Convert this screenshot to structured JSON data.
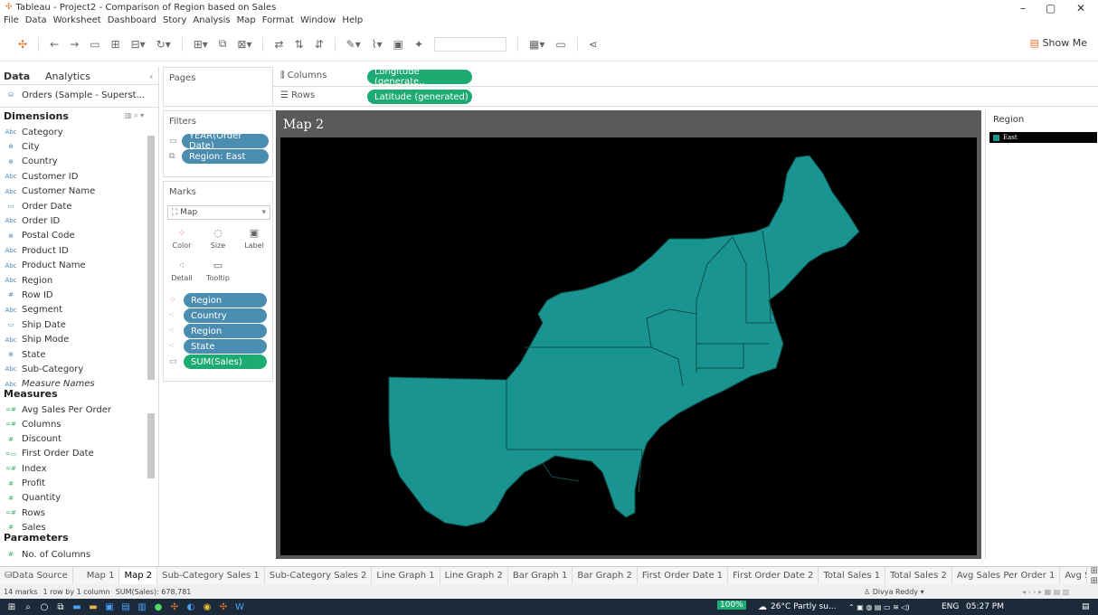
{
  "window": {
    "title": "Tableau - Project2 - Comparison of Region based on Sales"
  },
  "menu": [
    "File",
    "Data",
    "Worksheet",
    "Dashboard",
    "Story",
    "Analysis",
    "Map",
    "Format",
    "Window",
    "Help"
  ],
  "toolbar": {
    "show_me": "Show Me"
  },
  "data_panel": {
    "tab_data": "Data",
    "tab_analytics": "Analytics",
    "datasource": "Orders (Sample - Superst...",
    "dimensions_label": "Dimensions",
    "dimensions": [
      {
        "icon": "Abc",
        "name": "Category"
      },
      {
        "icon": "⊕",
        "name": "City"
      },
      {
        "icon": "⊕",
        "name": "Country"
      },
      {
        "icon": "Abc",
        "name": "Customer ID"
      },
      {
        "icon": "Abc",
        "name": "Customer Name"
      },
      {
        "icon": "▭",
        "name": "Order Date"
      },
      {
        "icon": "Abc",
        "name": "Order ID"
      },
      {
        "icon": "⊕",
        "name": "Postal Code"
      },
      {
        "icon": "Abc",
        "name": "Product ID"
      },
      {
        "icon": "Abc",
        "name": "Product Name"
      },
      {
        "icon": "Abc",
        "name": "Region"
      },
      {
        "icon": "#",
        "name": "Row ID"
      },
      {
        "icon": "Abc",
        "name": "Segment"
      },
      {
        "icon": "▭",
        "name": "Ship Date"
      },
      {
        "icon": "Abc",
        "name": "Ship Mode"
      },
      {
        "icon": "⊕",
        "name": "State"
      },
      {
        "icon": "Abc",
        "name": "Sub-Category"
      },
      {
        "icon": "Abc",
        "name": "Measure Names"
      }
    ],
    "measures_label": "Measures",
    "measures": [
      {
        "icon": "=#",
        "name": "Avg Sales Per Order"
      },
      {
        "icon": "=#",
        "name": "Columns"
      },
      {
        "icon": "#",
        "name": "Discount"
      },
      {
        "icon": "=▭",
        "name": "First Order Date"
      },
      {
        "icon": "=#",
        "name": "Index"
      },
      {
        "icon": "#",
        "name": "Profit"
      },
      {
        "icon": "#",
        "name": "Quantity"
      },
      {
        "icon": "=#",
        "name": "Rows"
      },
      {
        "icon": "#",
        "name": "Sales"
      }
    ],
    "parameters_label": "Parameters",
    "parameters": [
      {
        "icon": "#",
        "name": "No. of Columns"
      }
    ]
  },
  "pages": {
    "label": "Pages"
  },
  "filters": {
    "label": "Filters",
    "items": [
      "YEAR(Order Date)",
      "Region: East"
    ]
  },
  "marks": {
    "label": "Marks",
    "type": "Map",
    "buttons": [
      "Color",
      "Size",
      "Label",
      "Detail",
      "Tooltip"
    ],
    "pills": [
      "Region",
      "Country",
      "Region",
      "State",
      "SUM(Sales)"
    ]
  },
  "shelves": {
    "columns_label": "Columns",
    "columns_pill": "Longitude (generate..",
    "rows_label": "Rows",
    "rows_pill": "Latitude (generated)"
  },
  "view": {
    "title": "Map 2"
  },
  "legend": {
    "title": "Region",
    "item": "East",
    "color": "#1a9490"
  },
  "sheet_tabs": [
    "Data Source",
    "Map 1",
    "Map 2",
    "Sub-Category Sales 1",
    "Sub-Category Sales 2",
    "Line Graph 1",
    "Line Graph 2",
    "Bar Graph 1",
    "Bar Graph 2",
    "First Order Date 1",
    "First Order Date 2",
    "Total Sales 1",
    "Total Sales 2",
    "Avg Sales Per Order 1",
    "Avg Sales Per Orde"
  ],
  "status": {
    "marks": "14 marks",
    "rows_cols": "1 row by 1 column",
    "sum": "SUM(Sales): 678,781",
    "user": "Divya Reddy"
  },
  "taskbar": {
    "zoom": "100%",
    "weather": "26°C  Partly su...",
    "lang": "ENG",
    "time": "05:27 PM"
  }
}
